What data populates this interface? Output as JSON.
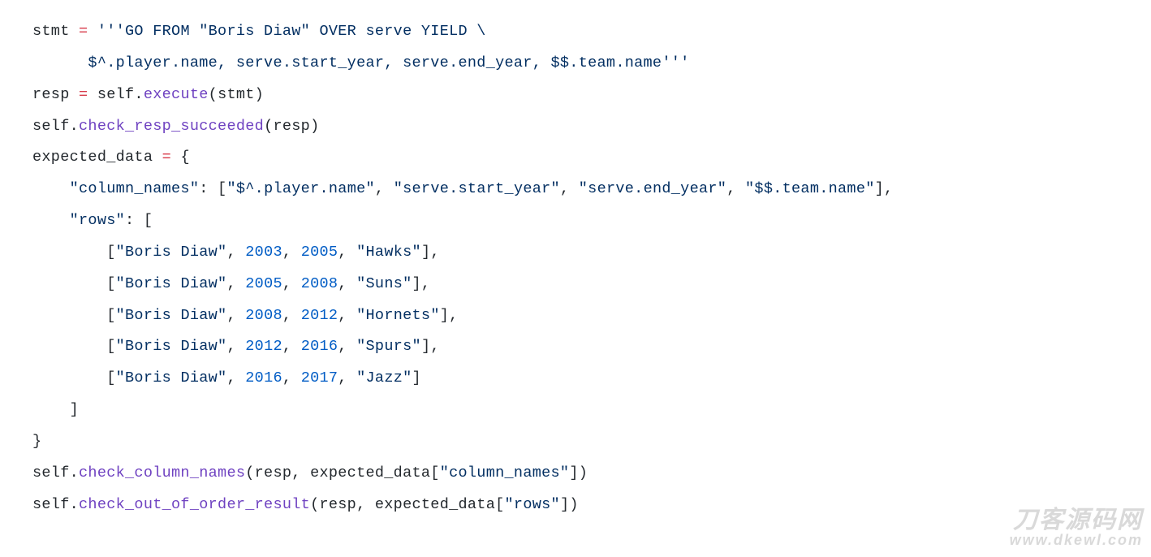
{
  "code_tokens": [
    [
      {
        "t": "stmt ",
        "c": "tok-default"
      },
      {
        "t": "=",
        "c": "tok-keyword"
      },
      {
        "t": " ",
        "c": "tok-default"
      },
      {
        "t": "'''GO FROM \"Boris Diaw\" OVER serve YIELD \\",
        "c": "tok-string"
      }
    ],
    [
      {
        "t": "      $^.player.name, serve.start_year, serve.end_year, $$.team.name'''",
        "c": "tok-string"
      }
    ],
    [
      {
        "t": "resp ",
        "c": "tok-default"
      },
      {
        "t": "=",
        "c": "tok-keyword"
      },
      {
        "t": " self.",
        "c": "tok-default"
      },
      {
        "t": "execute",
        "c": "tok-func"
      },
      {
        "t": "(stmt)",
        "c": "tok-default"
      }
    ],
    [
      {
        "t": "self.",
        "c": "tok-default"
      },
      {
        "t": "check_resp_succeeded",
        "c": "tok-func"
      },
      {
        "t": "(resp)",
        "c": "tok-default"
      }
    ],
    [
      {
        "t": "expected_data ",
        "c": "tok-default"
      },
      {
        "t": "=",
        "c": "tok-keyword"
      },
      {
        "t": " {",
        "c": "tok-default"
      }
    ],
    [
      {
        "t": "    ",
        "c": "tok-default"
      },
      {
        "t": "\"column_names\"",
        "c": "tok-string"
      },
      {
        "t": ": [",
        "c": "tok-default"
      },
      {
        "t": "\"$^.player.name\"",
        "c": "tok-string"
      },
      {
        "t": ", ",
        "c": "tok-default"
      },
      {
        "t": "\"serve.start_year\"",
        "c": "tok-string"
      },
      {
        "t": ", ",
        "c": "tok-default"
      },
      {
        "t": "\"serve.end_year\"",
        "c": "tok-string"
      },
      {
        "t": ", ",
        "c": "tok-default"
      },
      {
        "t": "\"$$.team.name\"",
        "c": "tok-string"
      },
      {
        "t": "],",
        "c": "tok-default"
      }
    ],
    [
      {
        "t": "    ",
        "c": "tok-default"
      },
      {
        "t": "\"rows\"",
        "c": "tok-string"
      },
      {
        "t": ": [",
        "c": "tok-default"
      }
    ],
    [
      {
        "t": "        [",
        "c": "tok-default"
      },
      {
        "t": "\"Boris Diaw\"",
        "c": "tok-string"
      },
      {
        "t": ", ",
        "c": "tok-default"
      },
      {
        "t": "2003",
        "c": "tok-number"
      },
      {
        "t": ", ",
        "c": "tok-default"
      },
      {
        "t": "2005",
        "c": "tok-number"
      },
      {
        "t": ", ",
        "c": "tok-default"
      },
      {
        "t": "\"Hawks\"",
        "c": "tok-string"
      },
      {
        "t": "],",
        "c": "tok-default"
      }
    ],
    [
      {
        "t": "        [",
        "c": "tok-default"
      },
      {
        "t": "\"Boris Diaw\"",
        "c": "tok-string"
      },
      {
        "t": ", ",
        "c": "tok-default"
      },
      {
        "t": "2005",
        "c": "tok-number"
      },
      {
        "t": ", ",
        "c": "tok-default"
      },
      {
        "t": "2008",
        "c": "tok-number"
      },
      {
        "t": ", ",
        "c": "tok-default"
      },
      {
        "t": "\"Suns\"",
        "c": "tok-string"
      },
      {
        "t": "],",
        "c": "tok-default"
      }
    ],
    [
      {
        "t": "        [",
        "c": "tok-default"
      },
      {
        "t": "\"Boris Diaw\"",
        "c": "tok-string"
      },
      {
        "t": ", ",
        "c": "tok-default"
      },
      {
        "t": "2008",
        "c": "tok-number"
      },
      {
        "t": ", ",
        "c": "tok-default"
      },
      {
        "t": "2012",
        "c": "tok-number"
      },
      {
        "t": ", ",
        "c": "tok-default"
      },
      {
        "t": "\"Hornets\"",
        "c": "tok-string"
      },
      {
        "t": "],",
        "c": "tok-default"
      }
    ],
    [
      {
        "t": "        [",
        "c": "tok-default"
      },
      {
        "t": "\"Boris Diaw\"",
        "c": "tok-string"
      },
      {
        "t": ", ",
        "c": "tok-default"
      },
      {
        "t": "2012",
        "c": "tok-number"
      },
      {
        "t": ", ",
        "c": "tok-default"
      },
      {
        "t": "2016",
        "c": "tok-number"
      },
      {
        "t": ", ",
        "c": "tok-default"
      },
      {
        "t": "\"Spurs\"",
        "c": "tok-string"
      },
      {
        "t": "],",
        "c": "tok-default"
      }
    ],
    [
      {
        "t": "        [",
        "c": "tok-default"
      },
      {
        "t": "\"Boris Diaw\"",
        "c": "tok-string"
      },
      {
        "t": ", ",
        "c": "tok-default"
      },
      {
        "t": "2016",
        "c": "tok-number"
      },
      {
        "t": ", ",
        "c": "tok-default"
      },
      {
        "t": "2017",
        "c": "tok-number"
      },
      {
        "t": ", ",
        "c": "tok-default"
      },
      {
        "t": "\"Jazz\"",
        "c": "tok-string"
      },
      {
        "t": "]",
        "c": "tok-default"
      }
    ],
    [
      {
        "t": "    ]",
        "c": "tok-default"
      }
    ],
    [
      {
        "t": "}",
        "c": "tok-default"
      }
    ],
    [
      {
        "t": "self.",
        "c": "tok-default"
      },
      {
        "t": "check_column_names",
        "c": "tok-func"
      },
      {
        "t": "(resp, expected_data[",
        "c": "tok-default"
      },
      {
        "t": "\"column_names\"",
        "c": "tok-string"
      },
      {
        "t": "])",
        "c": "tok-default"
      }
    ],
    [
      {
        "t": "self.",
        "c": "tok-default"
      },
      {
        "t": "check_out_of_order_result",
        "c": "tok-func"
      },
      {
        "t": "(resp, expected_data[",
        "c": "tok-default"
      },
      {
        "t": "\"rows\"",
        "c": "tok-string"
      },
      {
        "t": "])",
        "c": "tok-default"
      }
    ]
  ],
  "watermark": {
    "cn": "刀客源码网",
    "url": "www.dkewl.com"
  }
}
